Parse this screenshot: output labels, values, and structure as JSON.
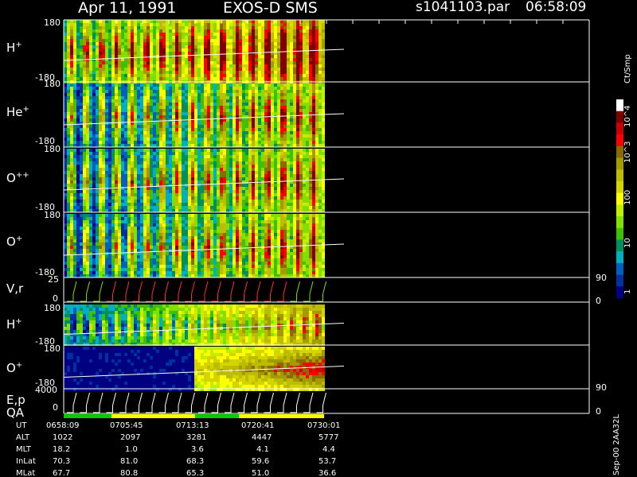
{
  "header": {
    "date": "Apr 11, 1991",
    "instrument": "EXOS-D SMS",
    "file": "s1041103.par",
    "time": "06:58:09"
  },
  "side_label": "Sep-00 2AA32L",
  "colorbar": {
    "unit": "Ct/Smp",
    "labels": [
      "10^4",
      "10^3",
      "100",
      "10",
      "1"
    ],
    "colors": [
      "#ffffff",
      "#800000",
      "#cc0000",
      "#ff0000",
      "#8b6b00",
      "#a59a00",
      "#bcbc00",
      "#d4d400",
      "#ffff00",
      "#c0f000",
      "#80e000",
      "#40c000",
      "#009060",
      "#00b0c0",
      "#0060c0",
      "#0030a0",
      "#000080"
    ]
  },
  "panels": [
    {
      "id": "h-plus",
      "label": "H",
      "sup": "+",
      "ymax": "180",
      "ymin": "-180"
    },
    {
      "id": "he-plus",
      "label": "He",
      "sup": "+",
      "ymax": "180",
      "ymin": "-180"
    },
    {
      "id": "o-plus-plus",
      "label": "O",
      "sup": "++",
      "ymax": "180",
      "ymin": "-180"
    },
    {
      "id": "o-plus",
      "label": "O",
      "sup": "+",
      "ymax": "180",
      "ymin": "-180"
    },
    {
      "id": "vr",
      "label": "V,r",
      "sup": "",
      "ymax": "25",
      "ymin": "0",
      "right_top": "90",
      "right_bottom": "0"
    },
    {
      "id": "h-plus-2",
      "label": "H",
      "sup": "+",
      "ymax": "180",
      "ymin": "-180"
    },
    {
      "id": "o-plus-2",
      "label": "O",
      "sup": "+",
      "ymax": "180",
      "ymin": "-180"
    },
    {
      "id": "ep",
      "label": "E,p",
      "sup": "",
      "ymax": "4000",
      "ymin": "0",
      "right_top": "90",
      "right_bottom": "0"
    }
  ],
  "qa_label": "QA",
  "footer": {
    "row_labels": [
      "UT",
      "ALT",
      "MLT",
      "InLat",
      "MLat"
    ],
    "columns": [
      {
        "UT": "0658:09",
        "ALT": "1022",
        "MLT": "18.2",
        "InLat": "70.3",
        "MLat": "67.7"
      },
      {
        "UT": "0705:45",
        "ALT": "2097",
        "MLT": "1.0",
        "InLat": "81.0",
        "MLat": "80.8"
      },
      {
        "UT": "0713:13",
        "ALT": "3281",
        "MLT": "3.6",
        "InLat": "68.3",
        "MLat": "65.3"
      },
      {
        "UT": "0720:41",
        "ALT": "4447",
        "MLT": "4.1",
        "InLat": "59.6",
        "MLat": "51.0"
      },
      {
        "UT": "0730:01",
        "ALT": "5777",
        "MLT": "4.4",
        "InLat": "53.7",
        "MLat": "36.6"
      }
    ]
  },
  "chart_data": {
    "type": "heatmap",
    "title": "Apr 11, 1991 EXOS-D SMS",
    "x_tick_labels": [
      "0658:09",
      "0705:45",
      "0713:13",
      "0720:41",
      "0730:01"
    ],
    "series": [
      {
        "name": "H+",
        "y_range": [
          -180,
          180
        ]
      },
      {
        "name": "He+",
        "y_range": [
          -180,
          180
        ]
      },
      {
        "name": "O++",
        "y_range": [
          -180,
          180
        ]
      },
      {
        "name": "O+",
        "y_range": [
          -180,
          180
        ]
      },
      {
        "name": "V,r",
        "y_range": [
          0,
          25
        ]
      },
      {
        "name": "H+",
        "y_range": [
          -180,
          180
        ]
      },
      {
        "name": "O+",
        "y_range": [
          -180,
          180
        ]
      },
      {
        "name": "E,p",
        "y_range": [
          0,
          4000
        ]
      }
    ],
    "color_scale": {
      "unit": "Ct/Smp",
      "ticks": [
        "1",
        "10",
        "100",
        "10^3",
        "10^4"
      ],
      "log": true
    }
  }
}
